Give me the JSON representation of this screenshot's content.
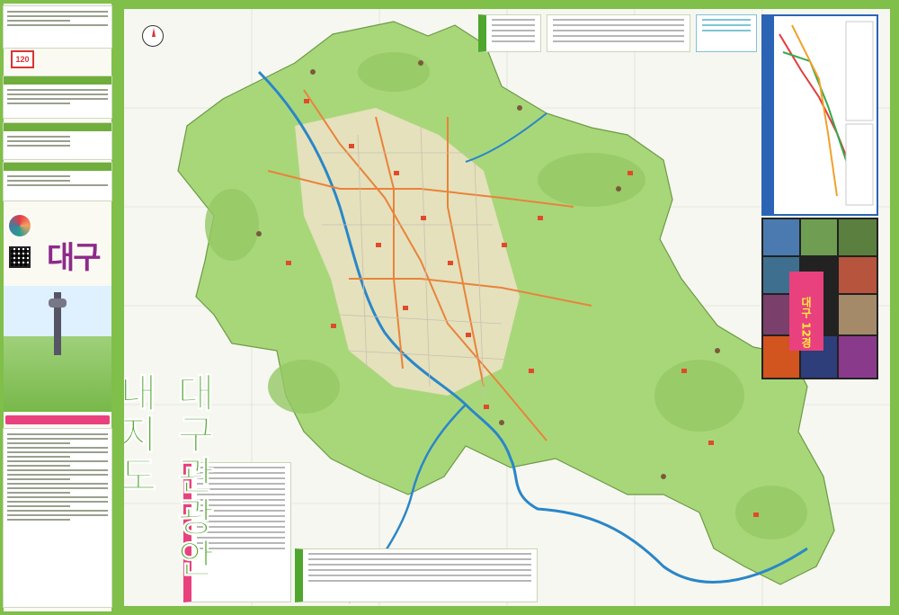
{
  "sidebar": {
    "hotline_number": "120",
    "city_logo_text": "대구"
  },
  "map": {
    "title": "대구관광안내지도",
    "gallery_badge": "대구 12경",
    "colors": {
      "frame_green": "#7fbf4a",
      "land_green": "#a8d77a",
      "river_blue": "#2a86c9",
      "road_orange": "#e9833a",
      "accent_pink": "#e8417e",
      "subway_blue": "#2b64b5"
    }
  }
}
